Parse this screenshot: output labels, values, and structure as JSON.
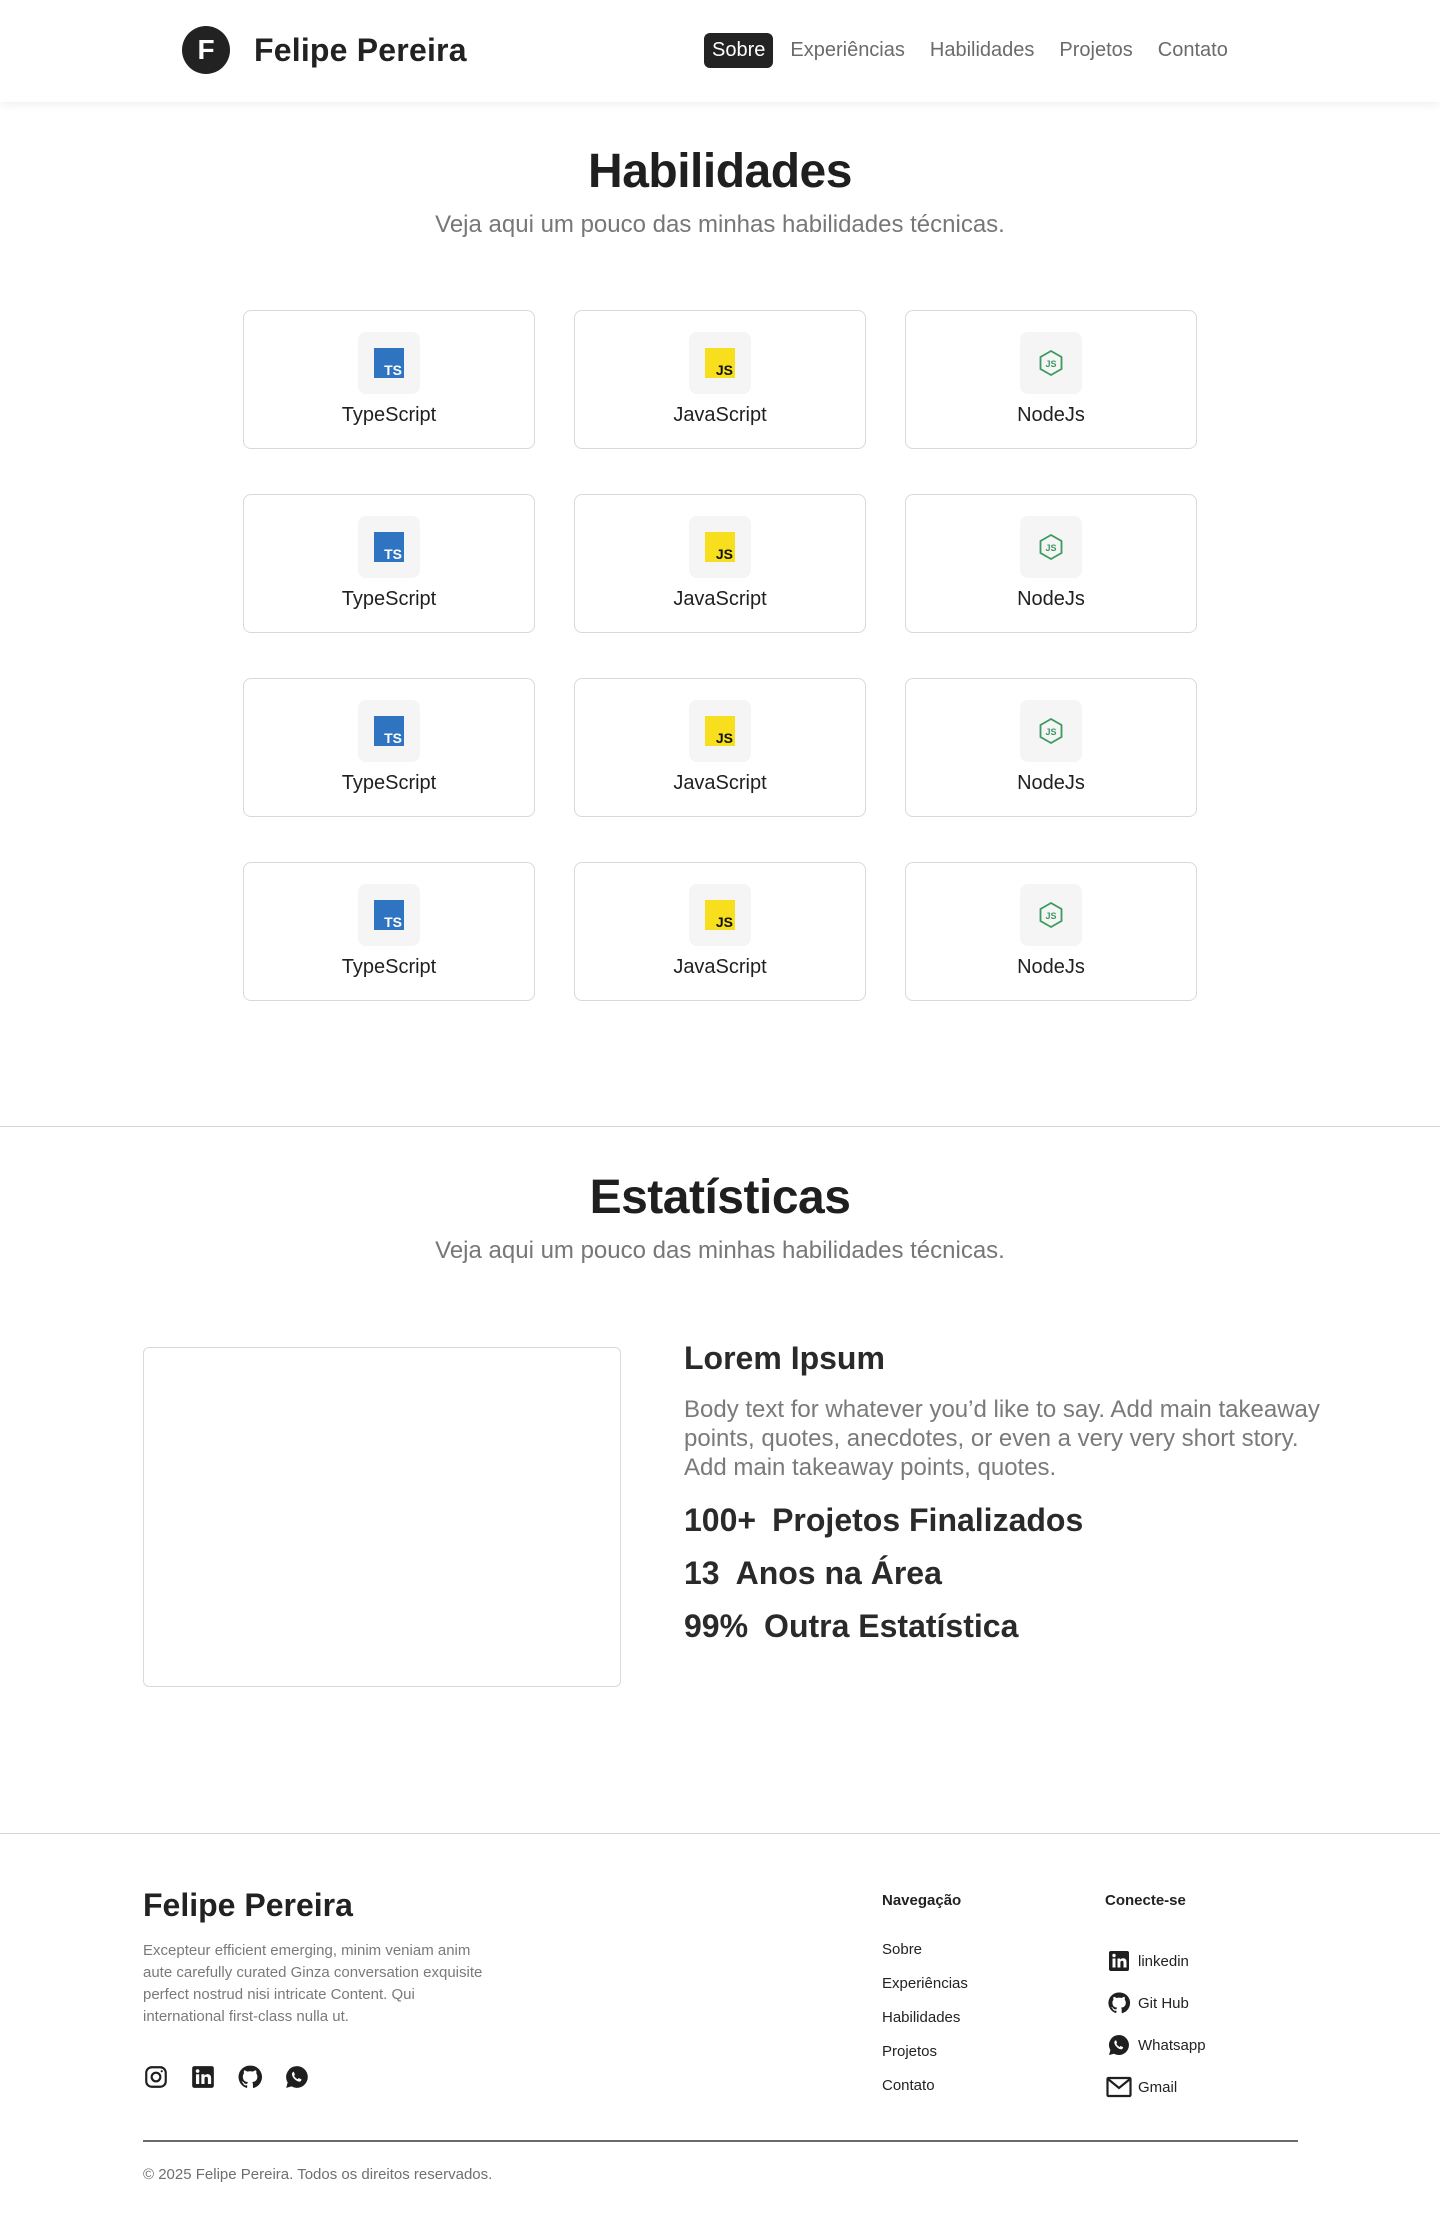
{
  "header": {
    "logo_letter": "F",
    "brand": "Felipe Pereira",
    "nav": [
      {
        "label": "Sobre",
        "active": true
      },
      {
        "label": "Experiências",
        "active": false
      },
      {
        "label": "Habilidades",
        "active": false
      },
      {
        "label": "Projetos",
        "active": false
      },
      {
        "label": "Contato",
        "active": false
      }
    ]
  },
  "skills": {
    "title": "Habilidades",
    "subtitle": "Veja aqui um pouco das minhas habilidades técnicas.",
    "cards": [
      {
        "label": "TypeScript",
        "icon": "typescript-icon",
        "badge": "TS"
      },
      {
        "label": "JavaScript",
        "icon": "javascript-icon",
        "badge": "JS"
      },
      {
        "label": "NodeJs",
        "icon": "nodejs-icon",
        "badge": "JS"
      },
      {
        "label": "TypeScript",
        "icon": "typescript-icon",
        "badge": "TS"
      },
      {
        "label": "JavaScript",
        "icon": "javascript-icon",
        "badge": "JS"
      },
      {
        "label": "NodeJs",
        "icon": "nodejs-icon",
        "badge": "JS"
      },
      {
        "label": "TypeScript",
        "icon": "typescript-icon",
        "badge": "TS"
      },
      {
        "label": "JavaScript",
        "icon": "javascript-icon",
        "badge": "JS"
      },
      {
        "label": "NodeJs",
        "icon": "nodejs-icon",
        "badge": "JS"
      },
      {
        "label": "TypeScript",
        "icon": "typescript-icon",
        "badge": "TS"
      },
      {
        "label": "JavaScript",
        "icon": "javascript-icon",
        "badge": "JS"
      },
      {
        "label": "NodeJs",
        "icon": "nodejs-icon",
        "badge": "JS"
      }
    ]
  },
  "stats": {
    "title": "Estatísticas",
    "subtitle": "Veja aqui um pouco das minhas habilidades técnicas.",
    "heading": "Lorem Ipsum",
    "body": "Body text for whatever you’d like to say. Add main takeaway points, quotes, anecdotes, or even a very very short story. Add main takeaway points, quotes.",
    "items": [
      {
        "value": "100+",
        "label": "Projetos Finalizados"
      },
      {
        "value": "13",
        "label": "Anos na Área"
      },
      {
        "value": "99%",
        "label": "Outra Estatística"
      }
    ]
  },
  "footer": {
    "brand": "Felipe Pereira",
    "description": "Excepteur efficient emerging, minim veniam anim aute carefully curated Ginza conversation exquisite perfect nostrud nisi intricate Content. Qui  international first-class nulla ut.",
    "social_icons": [
      "instagram-icon",
      "linkedin-icon",
      "github-icon",
      "whatsapp-icon"
    ],
    "nav_title": "Navegação",
    "nav_links": [
      "Sobre",
      "Experiências",
      "Habilidades",
      "Projetos",
      "Contato"
    ],
    "connect_title": "Conecte-se",
    "connect": [
      {
        "label": "linkedin",
        "icon": "linkedin-icon"
      },
      {
        "label": "Git Hub",
        "icon": "github-icon"
      },
      {
        "label": "Whatsapp",
        "icon": "whatsapp-icon"
      },
      {
        "label": "Gmail",
        "icon": "mail-icon"
      }
    ],
    "copyright": "© 2025 Felipe Pereira. Todos os direitos reservados."
  },
  "colors": {
    "typescript": "#2f74c0",
    "javascript": "#f7df1e",
    "nodejs": "#3c9a5f",
    "nav_active_bg": "#232323"
  }
}
